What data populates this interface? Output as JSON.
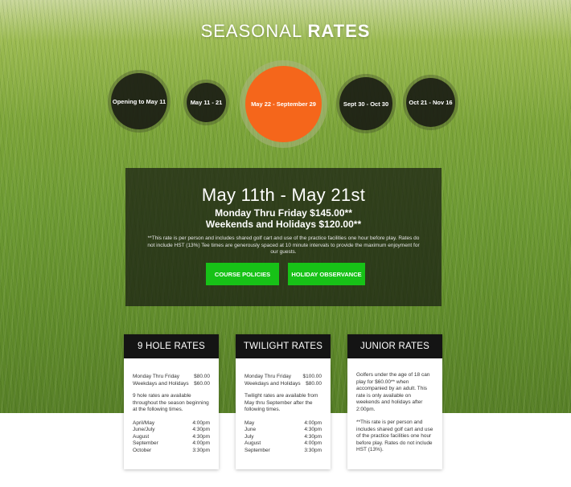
{
  "header": {
    "title_light": "SEASONAL ",
    "title_bold": "RATES"
  },
  "seasons": [
    {
      "label": "Opening to May 11"
    },
    {
      "label": "May 11 - 21"
    },
    {
      "label": "May 22 - September 29"
    },
    {
      "label": "Sept 30 - Oct 30"
    },
    {
      "label": "Oct 21 - Nov 16"
    }
  ],
  "active_color": "#f5661b",
  "panel": {
    "heading": "May 11th - May 21st",
    "weekday_label": "Monday Thru Friday ",
    "weekday_price": "$145.00**",
    "weekend_label": "Weekends and Holidays ",
    "weekend_price": "$120.00**",
    "note": "**This rate is per person and includes shared golf cart and use of the practice facilities one hour before play. Rates do not include HST (13%) Tee times are generously spaced at 10 minute intervals to provide the maximum enjoyment for our guests.",
    "buttons": {
      "policies": "COURSE POLICIES",
      "holiday": "HOLIDAY OBSERVANCE"
    }
  },
  "button_color": "#17c217",
  "cards": {
    "nine_hole": {
      "title": "9 HOLE RATES",
      "prices": [
        {
          "label": "Monday Thru Friday",
          "value": "$80.00"
        },
        {
          "label": "Weekdays and Holidays",
          "value": "$60.00"
        }
      ],
      "text": "9 hole rates are available throughout the season beginning at the following times.",
      "times": [
        {
          "month": "April/May",
          "time": "4:00pm"
        },
        {
          "month": "June/July",
          "time": "4:30pm"
        },
        {
          "month": "August",
          "time": "4:30pm"
        },
        {
          "month": "September",
          "time": "4:00pm"
        },
        {
          "month": "October",
          "time": "3:30pm"
        }
      ]
    },
    "twilight": {
      "title": "TWILIGHT RATES",
      "prices": [
        {
          "label": "Monday Thru Friday",
          "value": "$100.00"
        },
        {
          "label": "Weekdays and Holidays",
          "value": "$80.00"
        }
      ],
      "text": "Twilight rates are available from May thru September after the following times.",
      "times": [
        {
          "month": "May",
          "time": "4:00pm"
        },
        {
          "month": "June",
          "time": "4:30pm"
        },
        {
          "month": "July",
          "time": "4:30pm"
        },
        {
          "month": "August",
          "time": "4:00pm"
        },
        {
          "month": "September",
          "time": "3:30pm"
        }
      ]
    },
    "junior": {
      "title": "JUNIOR RATES",
      "text_1": "Golfers under the age of 18 can play for $60.00** when accompanied by an adult.  This rate is only available on weekends and holidays after 2:00pm.",
      "text_2": "**This rate is per person and includes shared golf cart and use of the practice facilities one hour before play. Rates do not include HST (13%)."
    }
  }
}
